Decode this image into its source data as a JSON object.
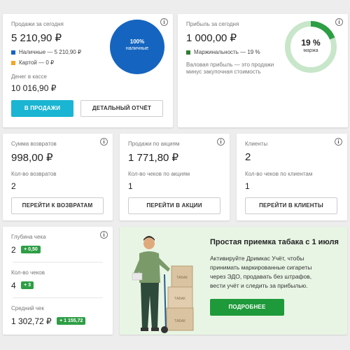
{
  "sales_today": {
    "title": "Продажи за сегодня",
    "amount": "5 210,90 ₽",
    "cash_label": "Наличные — 5 210,90 ₽",
    "card_label": "Картой — 0 ₽",
    "cash_in_register_label": "Денег в кассе",
    "cash_in_register": "10 016,90 ₽",
    "circle_percent": "100%",
    "circle_label": "наличные",
    "primary_button": "В ПРОДАЖИ",
    "report_button": "ДЕТАЛЬНЫЙ ОТЧЁТ",
    "cash_color": "#1565c0",
    "card_color": "#f5a623"
  },
  "profit_today": {
    "title": "Прибыль за сегодня",
    "amount": "1 000,00 ₽",
    "margin_label": "Маржинальность — 19 %",
    "note_line1": "Валовая прибыль — это продажи",
    "note_line2": "минус закупочная стоимость",
    "ring_percent": "19 %",
    "ring_label": "маржа",
    "ring_fraction": 0.19,
    "ring_color": "#2e9e45"
  },
  "returns": {
    "title": "Сумма возвратов",
    "amount": "998,00 ₽",
    "count_label": "Кол-во возвратов",
    "count": "2",
    "button": "ПЕРЕЙТИ К ВОЗВРАТАМ"
  },
  "promo_sales": {
    "title": "Продажи по акциям",
    "amount": "1 771,80 ₽",
    "count_label": "Кол-во чеков по акциям",
    "count": "1",
    "button": "ПЕРЕЙТИ В АКЦИИ"
  },
  "clients": {
    "title": "Клиенты",
    "amount": "2",
    "count_label": "Кол-во чеков по клиентам",
    "count": "1",
    "button": "ПЕРЕЙТИ В КЛИЕНТЫ"
  },
  "receipt_stats": {
    "depth_label": "Глубина чека",
    "depth_value": "2",
    "depth_badge": "+ 0,50",
    "count_label": "Кол-во чеков",
    "count_value": "4",
    "count_badge": "+ 3",
    "avg_label": "Средний чек",
    "avg_value": "1 302,72 ₽",
    "avg_badge": "+ 1 155,72"
  },
  "promo_banner": {
    "title": "Простая приемка табака с 1 июля",
    "line1": "Активируйте Дримкас Учёт, чтобы",
    "line2": "принимать маркированные сигареты",
    "line3": "через ЭДО, продавать без штрафов,",
    "line4": "вести учёт и следить за прибылью.",
    "button": "ПОДРОБНЕЕ",
    "box_label": "ТАБАК",
    "bg_color": "#e8f5e4"
  },
  "info_glyph": "i"
}
